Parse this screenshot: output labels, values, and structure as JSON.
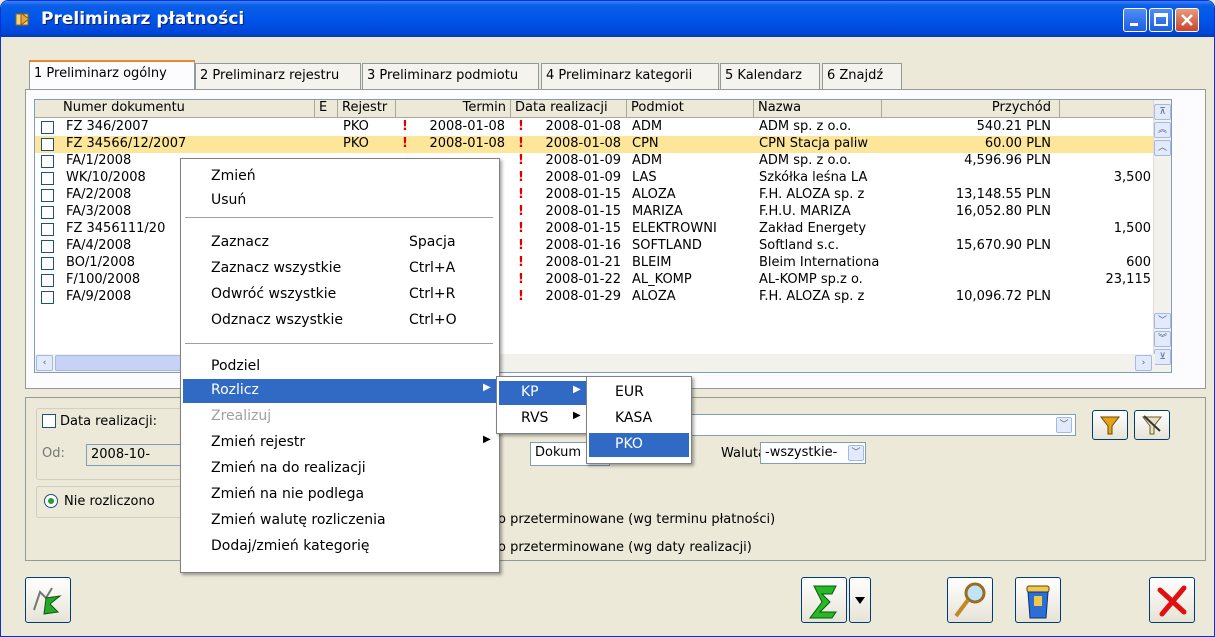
{
  "window": {
    "title": "Preliminarz płatności"
  },
  "tabs": [
    {
      "label": "1 Preliminarz ogólny"
    },
    {
      "label": "2 Preliminarz rejestru"
    },
    {
      "label": "3 Preliminarz podmiotu"
    },
    {
      "label": "4 Preliminarz kategorii"
    },
    {
      "label": "5 Kalendarz"
    },
    {
      "label": "6 Znajdź"
    }
  ],
  "grid": {
    "columns": [
      "Numer dokumentu",
      "E",
      "Rejestr",
      "Termin",
      "Data realizacji",
      "Podmiot",
      "Nazwa",
      "Przychód"
    ],
    "rows": [
      {
        "num": "FZ 346/2007",
        "rej": "PKO",
        "termin": "2008-01-08",
        "data": "2008-01-08",
        "podmiot": "ADM",
        "nazwa": "ADM sp. z o.o.",
        "przychod": "540.21 PLN",
        "rozchod": ""
      },
      {
        "num": "FZ 34566/12/2007",
        "rej": "PKO",
        "termin": "2008-01-08",
        "data": "2008-01-08",
        "podmiot": "CPN",
        "nazwa": "CPN Stacja paliw",
        "przychod": "60.00 PLN",
        "rozchod": ""
      },
      {
        "num": "FA/1/2008",
        "rej": "",
        "termin": "",
        "data": "2008-01-09",
        "podmiot": "ADM",
        "nazwa": "ADM sp. z o.o.",
        "przychod": "4,596.96 PLN",
        "rozchod": ""
      },
      {
        "num": "WK/10/2008",
        "rej": "",
        "termin": "",
        "data": "2008-01-09",
        "podmiot": "LAS",
        "nazwa": "Szkółka leśna LA",
        "przychod": "",
        "rozchod": "3,500"
      },
      {
        "num": "FA/2/2008",
        "rej": "",
        "termin": "",
        "data": "2008-01-15",
        "podmiot": "ALOZA",
        "nazwa": "F.H. ALOZA sp. z",
        "przychod": "13,148.55 PLN",
        "rozchod": ""
      },
      {
        "num": "FA/3/2008",
        "rej": "",
        "termin": "",
        "data": "2008-01-15",
        "podmiot": "MARIZA",
        "nazwa": "F.H.U. MARIZA",
        "przychod": "16,052.80 PLN",
        "rozchod": ""
      },
      {
        "num": "FZ 3456111/20",
        "rej": "",
        "termin": "",
        "data": "2008-01-15",
        "podmiot": "ELEKTROWNI",
        "nazwa": "Zakład Energety",
        "przychod": "",
        "rozchod": "1,500"
      },
      {
        "num": "FA/4/2008",
        "rej": "",
        "termin": "",
        "data": "2008-01-16",
        "podmiot": "SOFTLAND",
        "nazwa": "Softland s.c.",
        "przychod": "15,670.90 PLN",
        "rozchod": ""
      },
      {
        "num": "BO/1/2008",
        "rej": "",
        "termin": "",
        "data": "2008-01-21",
        "podmiot": "BLEIM",
        "nazwa": "Bleim Internationa",
        "przychod": "",
        "rozchod": "600"
      },
      {
        "num": "F/100/2008",
        "rej": "",
        "termin": "",
        "data": "2008-01-22",
        "podmiot": "AL_KOMP",
        "nazwa": "AL-KOMP sp.z o.",
        "przychod": "",
        "rozchod": "23,115"
      },
      {
        "num": "FA/9/2008",
        "rej": "",
        "termin": "",
        "data": "2008-01-29",
        "podmiot": "ALOZA",
        "nazwa": "F.H. ALOZA sp. z",
        "przychod": "10,096.72 PLN",
        "rozchod": ""
      }
    ]
  },
  "context_menu": {
    "items": [
      {
        "label": "Zmień",
        "shortcut": ""
      },
      {
        "label": "Usuń",
        "shortcut": ""
      },
      {
        "label": "Zaznacz",
        "shortcut": "Spacja"
      },
      {
        "label": "Zaznacz wszystkie",
        "shortcut": "Ctrl+A"
      },
      {
        "label": "Odwróć wszystkie",
        "shortcut": "Ctrl+R"
      },
      {
        "label": "Odznacz wszystkie",
        "shortcut": "Ctrl+O"
      },
      {
        "label": "Podziel",
        "shortcut": ""
      },
      {
        "label": "Rozlicz",
        "shortcut": ""
      },
      {
        "label": "Zrealizuj",
        "shortcut": ""
      },
      {
        "label": "Zmień rejestr",
        "shortcut": ""
      },
      {
        "label": "Zmień na do realizacji",
        "shortcut": ""
      },
      {
        "label": "Zmień na nie podlega",
        "shortcut": ""
      },
      {
        "label": "Zmień walutę rozliczenia",
        "shortcut": ""
      },
      {
        "label": "Dodaj/zmień kategorię",
        "shortcut": ""
      }
    ]
  },
  "submenu1": {
    "items": [
      "KP",
      "RVS"
    ]
  },
  "submenu2": {
    "items": [
      "EUR",
      "KASA",
      "PKO"
    ]
  },
  "filter": {
    "date_label": "Data realizacji:",
    "od_label": "Od:",
    "od_value": "2008-10-",
    "dokument_value": "Dokum",
    "waluta_label": "Waluta:",
    "waluta_value": "-wszystkie-",
    "radio_label": "Nie rozliczono",
    "overdue1": "o przeterminowane (wg terminu płatności)",
    "overdue2": "o przeterminowane (wg daty realizacji)"
  }
}
